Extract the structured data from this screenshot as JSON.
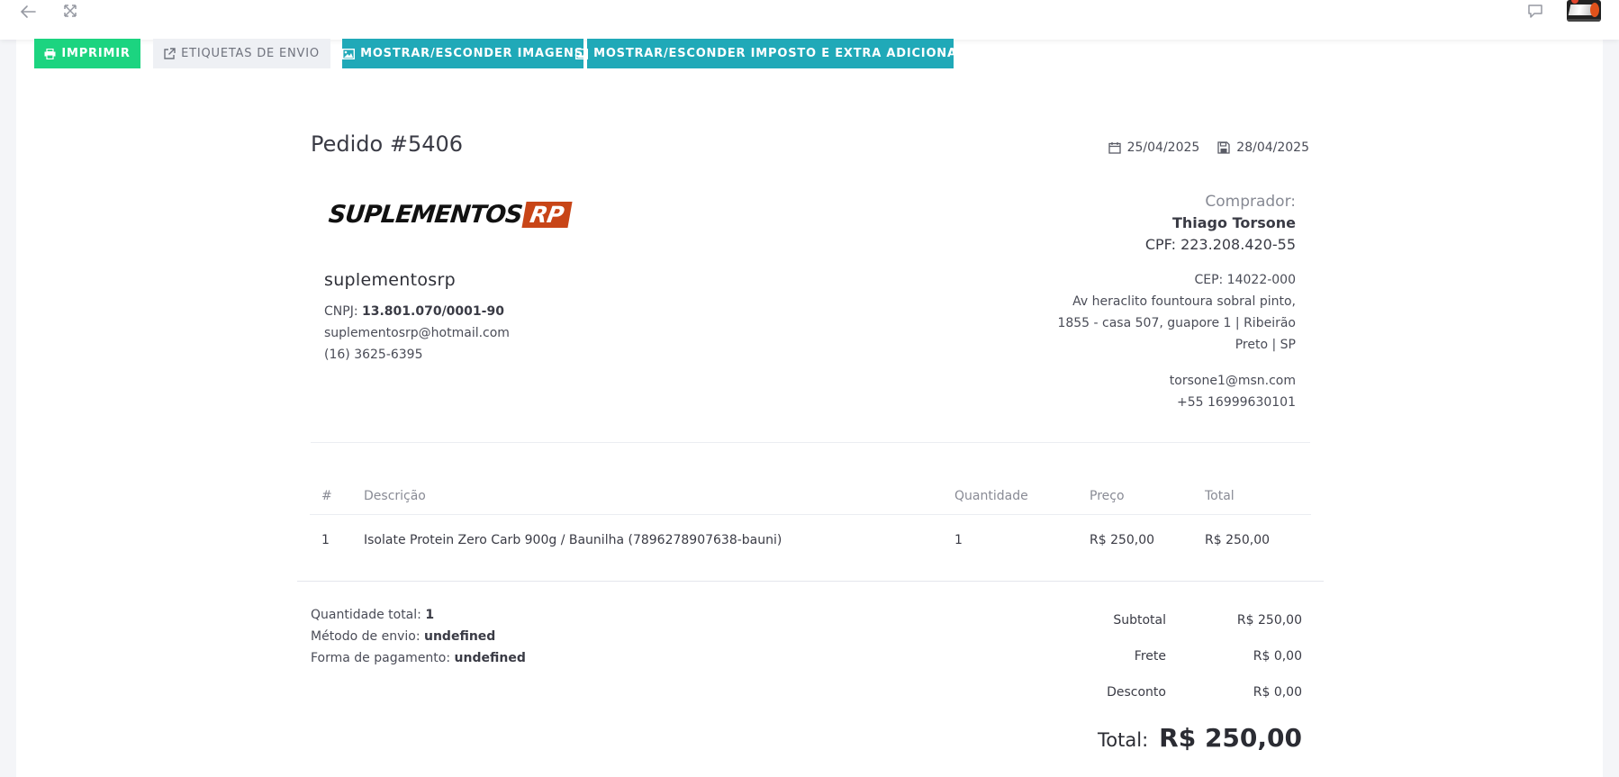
{
  "topbar": {
    "back_icon": "arrow-left-icon",
    "expand_icon": "expand-icon",
    "chat_icon": "chat-icon",
    "avatar": "avatar"
  },
  "toolbar": {
    "print_label": "IMPRIMIR",
    "shipping_labels_label": "ETIQUETAS DE ENVIO",
    "toggle_images_label": "MOSTRAR/ESCONDER IMAGENS",
    "toggle_tax_label": "MOSTRAR/ESCONDER IMPOSTO E EXTRA ADICIONAL"
  },
  "order": {
    "title": "Pedido #5406",
    "date_created": "25/04/2025",
    "date_saved": "28/04/2025"
  },
  "store": {
    "logo_part1": "SUPLEMENTOS",
    "logo_part2": "RP",
    "name": "suplementosrp",
    "cnpj_label": "CNPJ: ",
    "cnpj": "13.801.070/0001-90",
    "email": "suplementosrp@hotmail.com",
    "phone": "(16) 3625-6395"
  },
  "buyer": {
    "label": "Comprador:",
    "name": "Thiago Torsone",
    "cpf": "CPF: 223.208.420-55",
    "cep": "CEP: 14022-000",
    "address_line1": "Av heraclito fountoura sobral pinto,",
    "address_line2": "1855 - casa 507, guapore 1 | Ribeirão",
    "address_line3": "Preto | SP",
    "email": "torsone1@msn.com",
    "phone": "+55 16999630101"
  },
  "table": {
    "headers": [
      "#",
      "Descrição",
      "Quantidade",
      "Preço",
      "Total"
    ],
    "rows": [
      [
        "1",
        "Isolate Protein Zero Carb 900g / Baunilha (7896278907638-bauni)",
        "1",
        "R$ 250,00",
        "R$ 250,00"
      ]
    ]
  },
  "summary": {
    "qty_label": "Quantidade total: ",
    "qty_value": "1",
    "shipping_label": "Método de envio: ",
    "shipping_value": "undefined",
    "payment_label": "Forma de pagamento: ",
    "payment_value": "undefined"
  },
  "totals": {
    "subtotal_label": "Subtotal",
    "subtotal_value": "R$ 250,00",
    "freight_label": "Frete",
    "freight_value": "R$ 0,00",
    "discount_label": "Desconto",
    "discount_value": "R$ 0,00",
    "total_label": "Total:",
    "total_value": "R$ 250,00"
  },
  "colors": {
    "print_button": "#1cd480",
    "info_button": "#20a9b8",
    "logo_accent": "#c84517"
  }
}
